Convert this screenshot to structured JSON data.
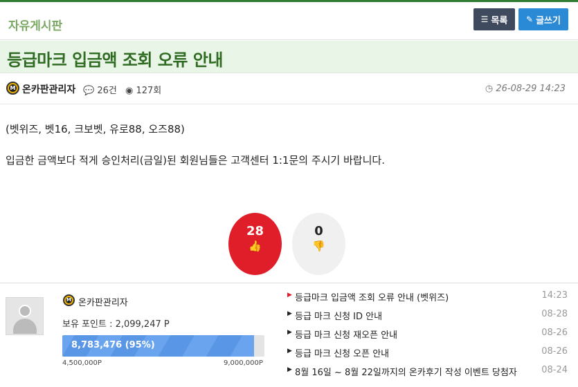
{
  "board": {
    "name": "자유게시판",
    "list_label": "목록",
    "write_label": "글쓰기"
  },
  "post": {
    "title": "등급마크 입금액 조회 오류 안내",
    "author": "온카판관리자",
    "comment_count": "26건",
    "view_count": "127회",
    "date": "26-08-29 14:23",
    "body": [
      "(벳위즈, 벳16, 크보벳, 유로88, 오즈88)",
      "입금한 금액보다 적게 승인처리(금일)된 회원님들은 고객센터 1:1문의 주시기 바랍니다."
    ],
    "upvotes": "28",
    "downvotes": "0"
  },
  "profile": {
    "badge_letter": "M",
    "name": "온카판관리자",
    "points_label": "보유 포인트 : 2,099,247 P",
    "progress_text": "8,783,476 (95%)",
    "progress_fraction": 0.95,
    "progress_min": "4,500,000P",
    "progress_max": "9,000,000P"
  },
  "recent_posts": [
    {
      "title": "등급마크 입금액 조회 오류 안내 (벳위즈)",
      "date": "14:23"
    },
    {
      "title": "등급 마크 신청 ID 안내",
      "date": "08-28"
    },
    {
      "title": "등급 마크 신청 재오픈 안내",
      "date": "08-26"
    },
    {
      "title": "등급 마크 신청 오픈 안내",
      "date": "08-26"
    },
    {
      "title": "8월 16일 ~ 8월 22일까지의 온카후기 작성 이벤트 당첨자",
      "date": "08-24"
    }
  ],
  "colors": {
    "accent_green": "#2f6b22",
    "upvote_red": "#e01e2a",
    "write_blue": "#2b8ad6",
    "list_dark": "#3f4a5e"
  },
  "icons": {
    "list": "list-icon",
    "write": "pencil-icon",
    "comment": "comment-icon",
    "views": "eye-icon",
    "clock": "clock-icon",
    "thumbs_up": "thumbs-up-icon",
    "thumbs_down": "thumbs-down-icon"
  }
}
